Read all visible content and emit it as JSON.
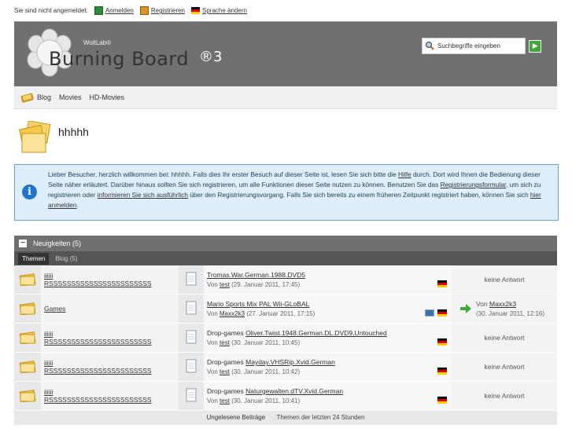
{
  "topbar": {
    "status": "Sie sind nicht angemeldet.",
    "login": "Anmelden",
    "register": "Registrieren",
    "language": "Sprache ändern"
  },
  "header": {
    "brand_small": "WoltLab®",
    "brand": "Burning Board",
    "brand_suffix": "®3",
    "search_placeholder": "Suchbegriffe eingeben"
  },
  "nav": {
    "items": [
      {
        "label": "Blog"
      },
      {
        "label": "Movies"
      },
      {
        "label": "HD-Movies"
      }
    ]
  },
  "page_title": "hhhhh",
  "info": {
    "p1": "Lieber Besucher, herzlich willkommen bei: hhhhh. Falls dies Ihr erster Besuch auf dieser Seite ist, lesen Sie sich bitte die ",
    "help_link": "Hilfe",
    "p2": " durch. Dort wird Ihnen die Bedienung dieser Seite näher erläutert. Darüber hinaus sollten Sie sich registrieren, um alle Funktionen dieser Seite nutzen zu können. Benutzen Sie das ",
    "reg_link": "Registrierungsformular",
    "p3": ", um sich zu registrieren oder ",
    "more_link": "informieren Sie sich ausführlich",
    "p4": " über den Registrierungsvorgang. Falls Sie sich bereits zu einem früheren Zeitpunkt registriert haben, können Sie sich ",
    "login_link": "hier anmelden",
    "p5": "."
  },
  "board": {
    "category": "Neuigkeiten (5)",
    "tab_active": "Themen",
    "tab_other": "Blog (5)",
    "rows": [
      {
        "name_top": "iiiiii",
        "name": "RSSSSSSSSSSSSSSSSSSSSSSS",
        "prefix": "",
        "topic": "Tromas.War.German.1988.DVD5",
        "by": "Von ",
        "author": "test",
        "date": " (29. Januar 2011, 17:45)",
        "response": "keine Antwort",
        "resp_author": "",
        "resp_date": ""
      },
      {
        "name_top": "",
        "name": "Games",
        "prefix": "",
        "topic": "Mario Sports Mix PAL Wii-GLoBAL",
        "by": "Von ",
        "author": "Maxx2k3",
        "date": " (27. Januar 2011, 17:15)",
        "response": "",
        "resp_author": "Maxx2k3",
        "resp_date": "(30. Januar 2011, 12:16)"
      },
      {
        "name_top": "iiiiii",
        "name": "RSSSSSSSSSSSSSSSSSSSSSSS",
        "prefix": "Drop-games ",
        "topic": "Oliver.Twist.1948.German.DL.DVD9.Untouched",
        "by": "Von ",
        "author": "test",
        "date": " (30. Januar 2011, 10:45)",
        "response": "keine Antwort",
        "resp_author": "",
        "resp_date": ""
      },
      {
        "name_top": "iiiiii",
        "name": "RSSSSSSSSSSSSSSSSSSSSSSS",
        "prefix": "Drop-games ",
        "topic": "Mayday.VHSRip.Xvid.German",
        "by": "Von ",
        "author": "test",
        "date": " (30. Januar 2011, 10:42)",
        "response": "keine Antwort",
        "resp_author": "",
        "resp_date": ""
      },
      {
        "name_top": "iiiiii",
        "name": "RSSSSSSSSSSSSSSSSSSSSSSS",
        "prefix": "Drop-games ",
        "topic": "Naturgewalten.dTV.Xvid.German",
        "by": "Von ",
        "author": "test",
        "date": " (30. Januar 2011, 10:41)",
        "response": "keine Antwort",
        "resp_author": "",
        "resp_date": ""
      }
    ],
    "footer_unread": "Ungelesene Beiträge",
    "footer_recent": "Themen der letzten 24 Stunden",
    "resp_prefix": "Von "
  }
}
